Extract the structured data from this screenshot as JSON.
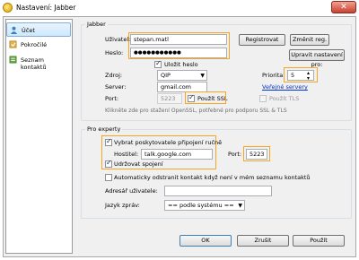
{
  "window": {
    "title": "Nastavení: Jabber",
    "close_glyph": "✕"
  },
  "sidebar": {
    "items": [
      {
        "label": "Účet",
        "icon": "account-icon",
        "selected": true
      },
      {
        "label": "Pokročilé",
        "icon": "advanced-icon",
        "selected": false
      },
      {
        "label": "Seznam kontaktů",
        "icon": "contacts-icon",
        "selected": false
      }
    ]
  },
  "jabber": {
    "group_title": "Jabber",
    "user_label": "Uživatel:",
    "user_value": "stepan.matl",
    "password_label": "Heslo:",
    "password_value": "●●●●●●●●●●●",
    "register_button": "Registrovat",
    "change_password_button": "Změnit reg.",
    "edit_server_button": "Upravit nastavení pro:",
    "save_password_label": "Uložit heslo",
    "source_label": "Zdroj:",
    "source_value": "QIP",
    "priority_label": "Priorita:",
    "priority_value": "5",
    "server_label": "Server:",
    "server_value": "gmail.com",
    "public_servers_link": "Veřejné servery",
    "port_label": "Port:",
    "port_value": "5223",
    "use_ssl_label": "Použít SSL",
    "use_tls_label": "Použít TLS",
    "openssl_hint": "Klikněte zde pro stažení OpenSSL, potřebné pro podporu SSL & TLS"
  },
  "expert": {
    "group_title": "Pro experty",
    "choose_provider_label": "Vybrat poskytovatele připojení ručně",
    "host_label": "Hostitel:",
    "host_value": "talk.google.com",
    "port_label": "Port:",
    "port_value": "5223",
    "keepalive_label": "Udržovat spojení",
    "auto_remove_label": "Automaticky odstranit kontakt když není v mém seznamu kontaktů",
    "user_address_label": "Adresář uživatele:",
    "user_address_value": "",
    "language_label": "Jazyk zpráv:",
    "language_value": "== podle systému =="
  },
  "buttons": {
    "ok": "OK",
    "cancel": "Zrušit",
    "apply": "Použít"
  },
  "colors": {
    "highlight": "#f6a623",
    "link": "#0033cc",
    "selection": "#cde8fb"
  }
}
